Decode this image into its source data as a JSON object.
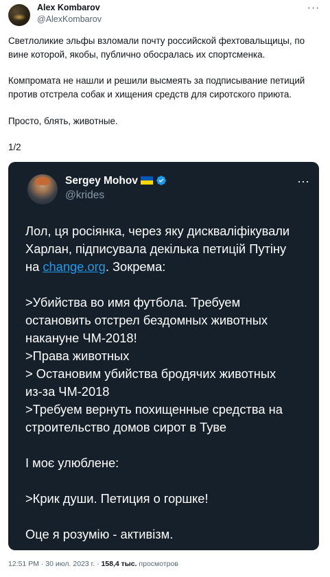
{
  "author": {
    "name": "Alex Kombarov",
    "handle": "@AlexKombarov"
  },
  "tweet": {
    "paragraph1_line1": "Светлоликие эльфы взломали почту российской фехтовальщицы, по",
    "paragraph1_line2": "вине которой, якобы, публично обосралась их спортсменка.",
    "paragraph2_line1": "Компромата не нашли и решили высмеять за подписывание петиций",
    "paragraph2_line2": "против отстрела собак и хищения средств для сиротского приюта.",
    "paragraph3": "Просто, блять, животные.",
    "thread_counter": "1/2"
  },
  "quote": {
    "name": "Sergey Mohov",
    "handle": "@krides",
    "lines": {
      "l1": "Лол, ця росіянка, через яку дискваліфікували",
      "l2": "Харлан, підписувала декілька петицій Путіну",
      "l3_pre": "на ",
      "l3_link": "change.org",
      "l3_post": ". Зокрема:",
      "l4": ">Убийства во имя футбола. Требуем",
      "l5": "остановить отстрел бездомных животных",
      "l6": "накануне ЧМ-2018!",
      "l7": ">Права животных",
      "l8": "> Остановим убийства бродячих животных",
      "l9": "из-за ЧМ-2018",
      "l10": ">Требуем вернуть похищенные средства на",
      "l11": "строительство домов сирот в Туве",
      "l12": "І моє улюблене:",
      "l13": ">Крик души. Петиция о горшке!",
      "l14": "Оце я розумію - активізм."
    }
  },
  "meta": {
    "time": "12:51 PM",
    "sep1": " · ",
    "date": "30 июл. 2023 г.",
    "sep2": " · ",
    "views": "158,4 тыс.",
    "views_label": " просмотров"
  },
  "colors": {
    "quote_bg": "#15202b",
    "link": "#1d9bf0",
    "verified": "#1d9bf0"
  },
  "icons": [
    "more-icon",
    "verified-icon",
    "ukraine-flag-icon"
  ]
}
